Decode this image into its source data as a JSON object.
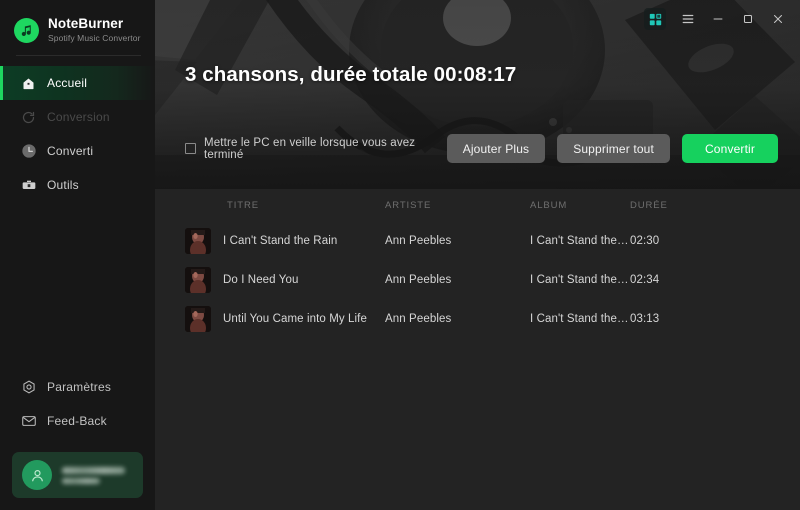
{
  "brand": {
    "name": "NoteBurner",
    "subtitle": "Spotify Music Convertor",
    "logo_icon": "music-note-icon",
    "accent": "#1ed760"
  },
  "sidebar": {
    "items": [
      {
        "label": "Accueil",
        "icon": "home-icon",
        "active": true,
        "disabled": false
      },
      {
        "label": "Conversion",
        "icon": "refresh-icon",
        "active": false,
        "disabled": true
      },
      {
        "label": "Converti",
        "icon": "clock-icon",
        "active": false,
        "disabled": false
      },
      {
        "label": "Outils",
        "icon": "toolbox-icon",
        "active": false,
        "disabled": false
      }
    ],
    "bottom_items": [
      {
        "label": "Paramètres",
        "icon": "gear-icon"
      },
      {
        "label": "Feed-Back",
        "icon": "envelope-icon"
      }
    ],
    "account": {
      "avatar_icon": "user-avatar-icon",
      "name_line": "",
      "plan_line": "",
      "obscured": true,
      "background": "#1d3a2a"
    }
  },
  "window_controls": {
    "grid": "grid-apps-icon",
    "menu": "hamburger-menu-icon",
    "minimize": "minimize-icon",
    "maximize": "maximize-icon",
    "close": "close-icon",
    "grid_color": "#1fc8b8"
  },
  "hero": {
    "title": "3 chansons, durée totale 00:08:17",
    "sleep_checkbox": {
      "label": "Mettre le PC en veille lorsque vous avez terminé",
      "checked": false
    },
    "buttons": [
      {
        "label": "Ajouter Plus",
        "style": "grey"
      },
      {
        "label": "Supprimer tout",
        "style": "grey"
      },
      {
        "label": "Convertir",
        "style": "green",
        "color": "#16d15e"
      }
    ]
  },
  "table": {
    "columns": [
      "TITRE",
      "ARTISTE",
      "ALBUM",
      "DURÉE"
    ],
    "rows": [
      {
        "title": "I Can't Stand the Rain",
        "artist": "Ann Peebles",
        "album": "I Can't Stand the…",
        "duration": "02:30",
        "thumb": "album-art-thumbnail"
      },
      {
        "title": "Do I Need You",
        "artist": "Ann Peebles",
        "album": "I Can't Stand the…",
        "duration": "02:34",
        "thumb": "album-art-thumbnail"
      },
      {
        "title": "Until You Came into My Life",
        "artist": "Ann Peebles",
        "album": "I Can't Stand the…",
        "duration": "03:13",
        "thumb": "album-art-thumbnail"
      }
    ]
  }
}
